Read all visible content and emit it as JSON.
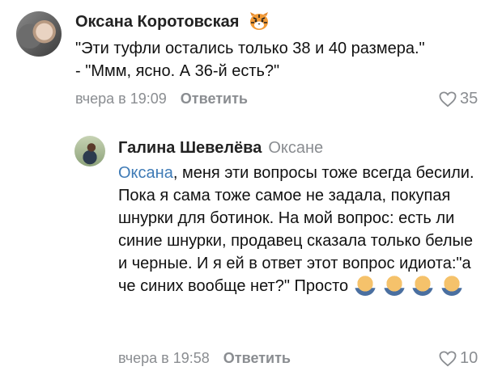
{
  "comments": [
    {
      "author": "Оксана Коротовская",
      "text_line1": "\"Эти туфли остались только 38 и 40 размера.\"",
      "text_line2": "- \"Ммм, ясно. А 36-й есть?\"",
      "time": "вчера в 19:09",
      "reply_label": "Ответить",
      "likes": "35",
      "avatar_icon": "user-avatar",
      "badge_icon": "tiger-emoji"
    },
    {
      "author": "Галина Шевелёва",
      "reply_to": "Оксане",
      "mention": "Оксана",
      "text": ", меня эти вопросы тоже всегда бесили. Пока я сама тоже самое не задала, покупая шнурки для ботинок. На мой вопрос: есть ли синие шнурки, продавец сказала только белые и черные. И я ей в ответ этот вопрос идиота:\"а че синих вообще нет?\" Просто",
      "emoji_icon": "facepalm-emoji",
      "emoji_count": 4,
      "time": "вчера в 19:58",
      "reply_label": "Ответить",
      "likes": "10",
      "avatar_icon": "user-avatar"
    }
  ],
  "colors": {
    "mention": "#3f7bb6",
    "meta": "#8a8d91"
  }
}
